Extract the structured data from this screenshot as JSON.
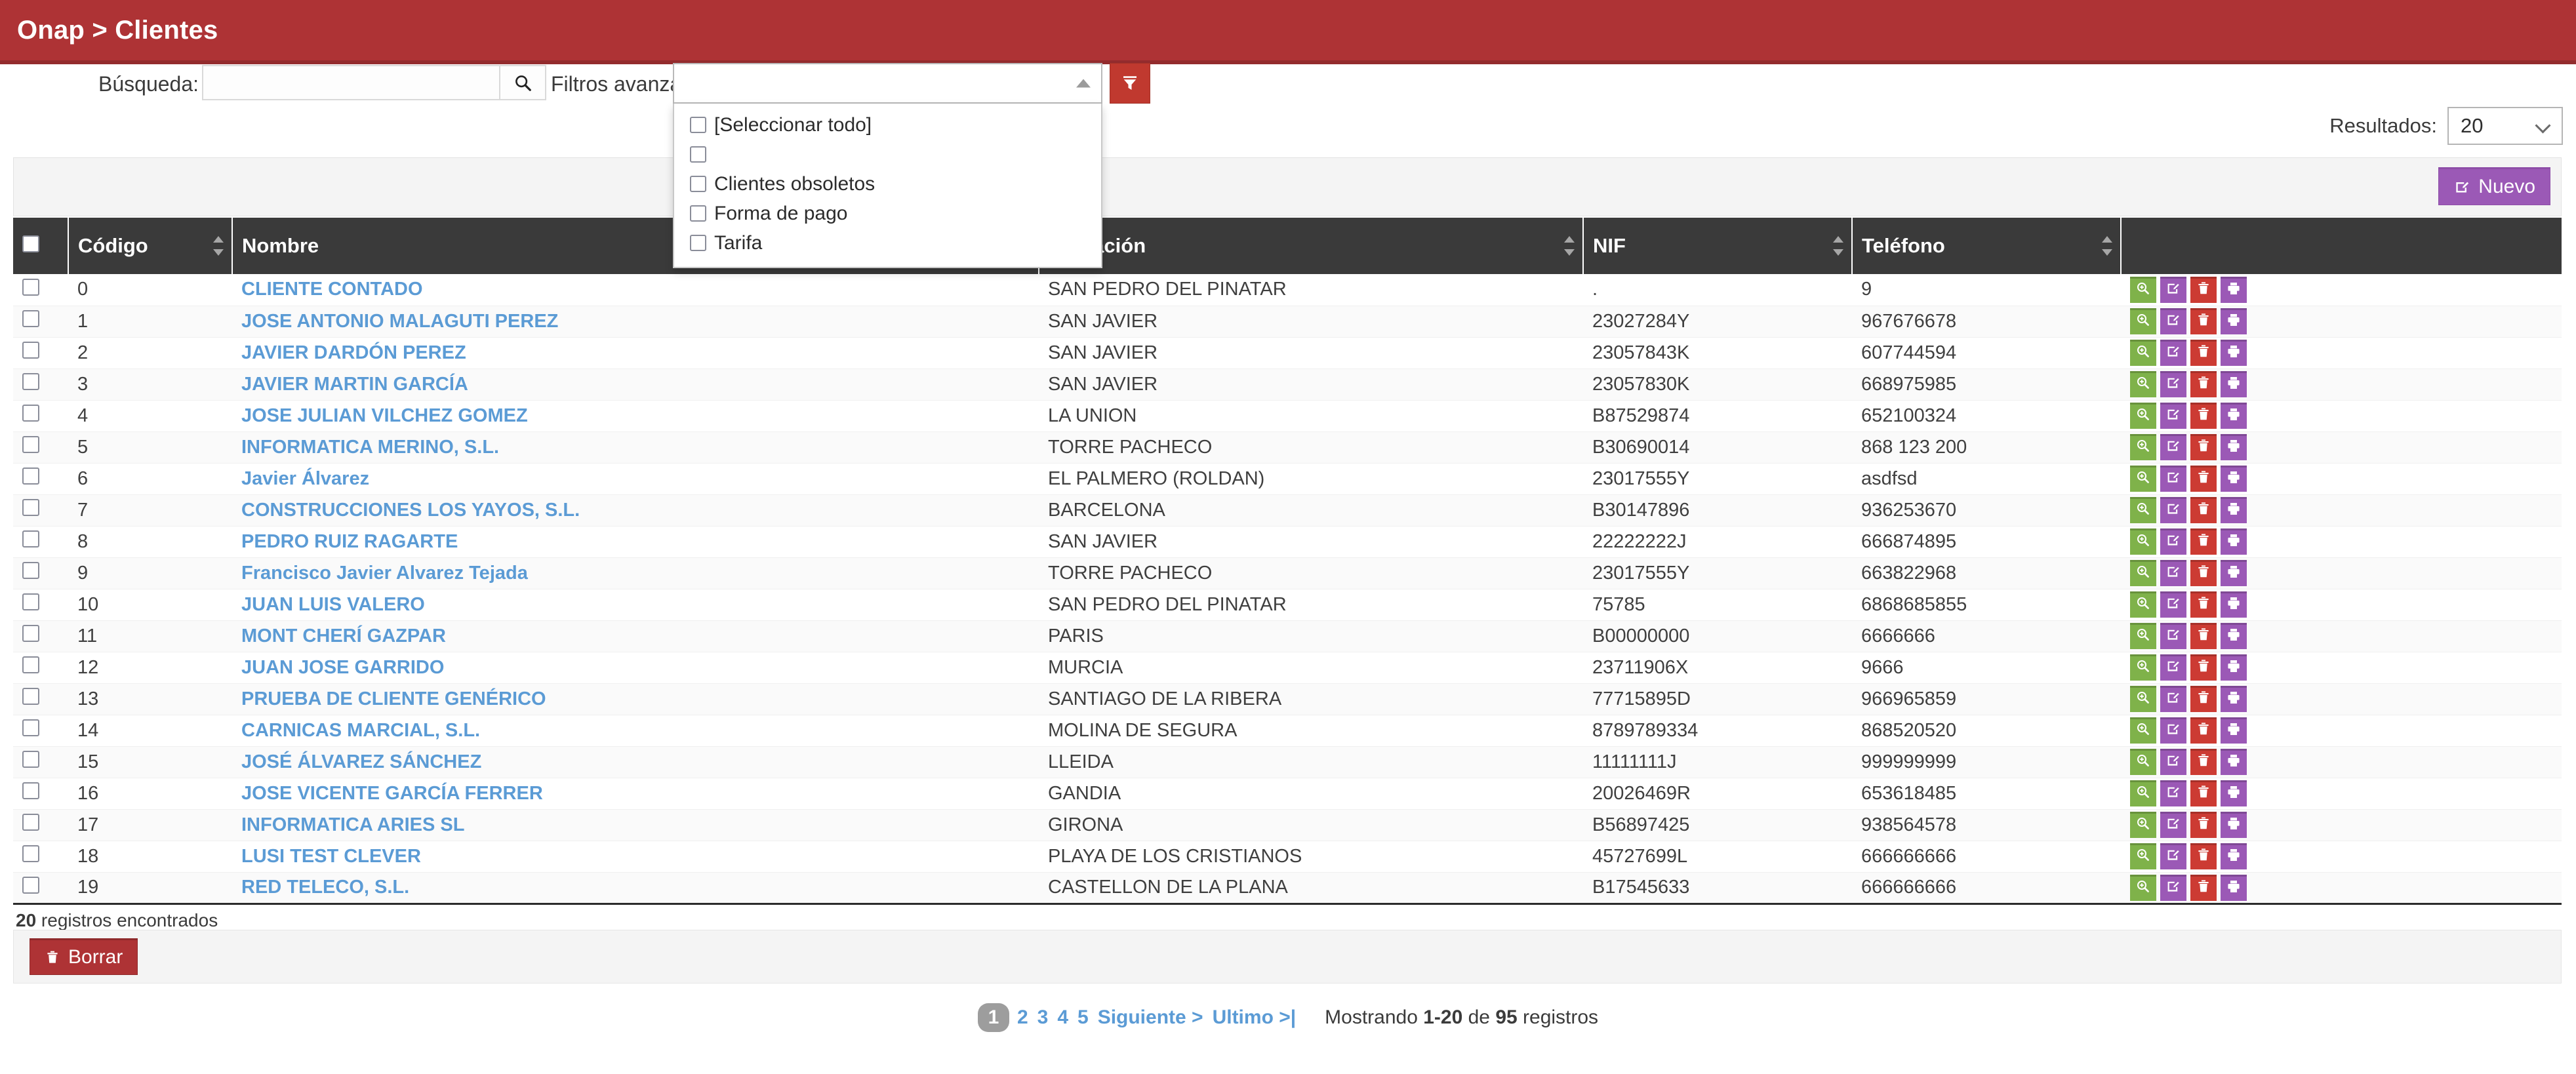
{
  "header": {
    "breadcrumb": "Onap > Clientes",
    "brand_color": "#ae3335"
  },
  "toolbar": {
    "search_label": "Búsqueda:",
    "search_value": "",
    "search_placeholder": "",
    "search_icon": "search-icon",
    "advanced_filters_label": "Filtros avanzados:",
    "advanced_filters_value": "",
    "apply_filter_icon": "funnel-icon",
    "results_label": "Resultados:",
    "results_value": "20",
    "results_options": [
      "20"
    ]
  },
  "filter_menu": {
    "open": true,
    "items": [
      {
        "label": "[Seleccionar todo]",
        "checked": false
      },
      {
        "label": "",
        "checked": false
      },
      {
        "label": "Clientes obsoletos",
        "checked": false
      },
      {
        "label": "Forma de pago",
        "checked": false
      },
      {
        "label": "Tarifa",
        "checked": false
      }
    ]
  },
  "actions": {
    "new_label": "Nuevo",
    "new_icon": "edit-square-icon",
    "delete_label": "Borrar",
    "delete_icon": "trash-icon"
  },
  "table": {
    "select_all_checked": false,
    "columns": [
      {
        "key": "select",
        "label": "",
        "sortable": false
      },
      {
        "key": "codigo",
        "label": "Código",
        "sortable": true
      },
      {
        "key": "nombre",
        "label": "Nombre",
        "sortable": true
      },
      {
        "key": "poblacion",
        "label": "Población",
        "sortable": true
      },
      {
        "key": "nif",
        "label": "NIF",
        "sortable": true
      },
      {
        "key": "telefono",
        "label": "Teléfono",
        "sortable": true
      },
      {
        "key": "acciones",
        "label": "",
        "sortable": false
      }
    ],
    "row_actions": [
      {
        "name": "view-button",
        "icon": "magnifier-plus-icon",
        "color": "#7fb24a"
      },
      {
        "name": "edit-button",
        "icon": "edit-square-icon",
        "color": "#9b59b6"
      },
      {
        "name": "delete-button",
        "icon": "trash-icon",
        "color": "#cc3b33"
      },
      {
        "name": "print-button",
        "icon": "printer-icon",
        "color": "#9b59b6"
      }
    ],
    "rows": [
      {
        "codigo": "0",
        "nombre": "CLIENTE CONTADO",
        "poblacion": "SAN PEDRO DEL PINATAR",
        "nif": ".",
        "telefono": "9"
      },
      {
        "codigo": "1",
        "nombre": "JOSE ANTONIO MALAGUTI PEREZ",
        "poblacion": "SAN JAVIER",
        "nif": "23027284Y",
        "telefono": "967676678"
      },
      {
        "codigo": "2",
        "nombre": "JAVIER DARDÓN PEREZ",
        "poblacion": "SAN JAVIER",
        "nif": "23057843K",
        "telefono": "607744594"
      },
      {
        "codigo": "3",
        "nombre": "JAVIER MARTIN GARCÍA",
        "poblacion": "SAN JAVIER",
        "nif": "23057830K",
        "telefono": "668975985"
      },
      {
        "codigo": "4",
        "nombre": "JOSE JULIAN VILCHEZ GOMEZ",
        "poblacion": "LA UNION",
        "nif": "B87529874",
        "telefono": "652100324"
      },
      {
        "codigo": "5",
        "nombre": "INFORMATICA MERINO, S.L.",
        "poblacion": "TORRE PACHECO",
        "nif": "B30690014",
        "telefono": "868 123 200"
      },
      {
        "codigo": "6",
        "nombre": "Javier Álvarez",
        "poblacion": "EL PALMERO (ROLDAN)",
        "nif": "23017555Y",
        "telefono": "asdfsd"
      },
      {
        "codigo": "7",
        "nombre": "CONSTRUCCIONES LOS YAYOS, S.L.",
        "poblacion": "BARCELONA",
        "nif": "B30147896",
        "telefono": "936253670"
      },
      {
        "codigo": "8",
        "nombre": "PEDRO RUIZ RAGARTE",
        "poblacion": "SAN JAVIER",
        "nif": "22222222J",
        "telefono": "666874895"
      },
      {
        "codigo": "9",
        "nombre": "Francisco Javier Alvarez Tejada",
        "poblacion": "TORRE PACHECO",
        "nif": "23017555Y",
        "telefono": "663822968"
      },
      {
        "codigo": "10",
        "nombre": "JUAN LUIS VALERO",
        "poblacion": "SAN PEDRO DEL PINATAR",
        "nif": "75785",
        "telefono": "6868685855"
      },
      {
        "codigo": "11",
        "nombre": "MONT CHERÍ GAZPAR",
        "poblacion": "PARIS",
        "nif": "B00000000",
        "telefono": "6666666"
      },
      {
        "codigo": "12",
        "nombre": "JUAN JOSE GARRIDO",
        "poblacion": "MURCIA",
        "nif": "23711906X",
        "telefono": "9666"
      },
      {
        "codigo": "13",
        "nombre": "PRUEBA DE CLIENTE GENÉRICO",
        "poblacion": "SANTIAGO DE LA RIBERA",
        "nif": "77715895D",
        "telefono": "966965859"
      },
      {
        "codigo": "14",
        "nombre": "CARNICAS MARCIAL, S.L.",
        "poblacion": "MOLINA DE SEGURA",
        "nif": "8789789334",
        "telefono": "868520520"
      },
      {
        "codigo": "15",
        "nombre": "JOSÉ ÁLVAREZ SÁNCHEZ",
        "poblacion": "LLEIDA",
        "nif": "11111111J",
        "telefono": "999999999"
      },
      {
        "codigo": "16",
        "nombre": "JOSE VICENTE GARCÍA FERRER",
        "poblacion": "GANDIA",
        "nif": "20026469R",
        "telefono": "653618485"
      },
      {
        "codigo": "17",
        "nombre": "INFORMATICA ARIES SL",
        "poblacion": "GIRONA",
        "nif": "B56897425",
        "telefono": "938564578"
      },
      {
        "codigo": "18",
        "nombre": "LUSI TEST CLEVER",
        "poblacion": "PLAYA DE LOS CRISTIANOS",
        "nif": "45727699L",
        "telefono": "666666666"
      },
      {
        "codigo": "19",
        "nombre": "RED TELECO, S.L.",
        "poblacion": "CASTELLON DE LA PLANA",
        "nif": "B17545633",
        "telefono": "666666666"
      }
    ]
  },
  "footer": {
    "records_found_count": "20",
    "records_found_text": " registros encontrados",
    "pagination": {
      "current_page": "1",
      "pages": [
        "2",
        "3",
        "4",
        "5"
      ],
      "next_label": "Siguiente >",
      "last_label": "Ultimo >|",
      "showing_prefix": "Mostrando ",
      "showing_range": "1-20",
      "showing_middle": " de ",
      "showing_total": "95",
      "showing_suffix": " registros"
    }
  }
}
